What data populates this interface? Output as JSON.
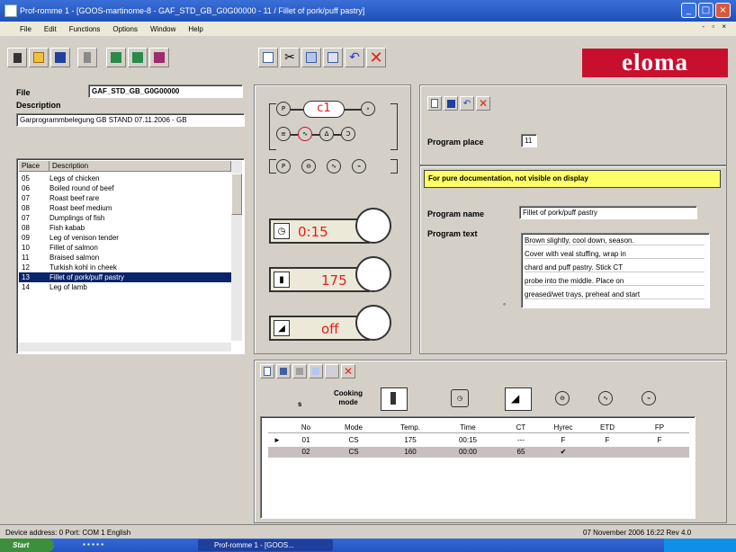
{
  "window": {
    "title": "Prof-romme 1 - [GOOS-martinome-8 - GAF_STD_GB_G0G00000 - 11 / Fillet of pork/puff pastry]"
  },
  "menu": [
    "File",
    "Edit",
    "Functions",
    "Options",
    "Window",
    "Help"
  ],
  "brand": {
    "logo_text": "eloma",
    "logo_color": "#c8102e"
  },
  "file_panel": {
    "file_label": "File",
    "file_value": "GAF_STD_GB_G0G00000",
    "description_label": "Description",
    "description_value": "Garprogrammbelegung GB STAND 07.11.2006 - GB"
  },
  "program_list": {
    "headers": [
      "Place",
      "Description"
    ],
    "rows": [
      {
        "place": "05",
        "desc": "Legs of chicken"
      },
      {
        "place": "06",
        "desc": "Boiled round of beef"
      },
      {
        "place": "07",
        "desc": "Roast beef rare"
      },
      {
        "place": "08",
        "desc": "Roast beef medium"
      },
      {
        "place": "07",
        "desc": "Dumplings of fish"
      },
      {
        "place": "08",
        "desc": "Fish kabab"
      },
      {
        "place": "09",
        "desc": "Leg of venison tender"
      },
      {
        "place": "10",
        "desc": "Fillet of salmon"
      },
      {
        "place": "11",
        "desc": "Braised salmon"
      },
      {
        "place": "12",
        "desc": "Turkish kohl in cheek"
      },
      {
        "place": "13",
        "desc": "Fillet of pork/puff pastry",
        "selected": true
      },
      {
        "place": "14",
        "desc": "Leg of lamb"
      }
    ]
  },
  "cooking_panel": {
    "mode_display": "c1",
    "time_value": "0:15",
    "temp_value": "175",
    "fan_value": "off"
  },
  "program_place": {
    "label": "Program place",
    "value": "11"
  },
  "info_panel": {
    "notice": "For pure documentation, not visible on display",
    "name_label": "Program name",
    "name_value": "Fillet of pork/puff pastry",
    "text_label": "Program text",
    "text_lines": [
      "Brown slightly, cool down, season.",
      "Cover with veal stuffing, wrap in",
      "chard and puff pastry. Stick CT",
      "probe into the middle. Place on",
      "greased/wet trays, preheat and start"
    ]
  },
  "steps": {
    "col_s": "s",
    "cooking_mode_label": "Cooking mode",
    "headers": [
      "No",
      "Mode",
      "Temp.",
      "Time",
      "CT",
      "Hyrec",
      "ETD",
      "FP"
    ],
    "rows": [
      {
        "no": "01",
        "mode": "CS",
        "temp": "175",
        "time": "00:15",
        "ct": "---",
        "hyrec": "F",
        "etd": "F",
        "fp": "F",
        "marker": "►"
      },
      {
        "no": "02",
        "mode": "CS",
        "temp": "160",
        "time": "00:00",
        "ct": "65",
        "hyrec": "✔",
        "etd": "",
        "fp": "",
        "marker": ""
      }
    ]
  },
  "statusbar": {
    "left": "Device address: 0    Port: COM 1    English",
    "right": "07 November 2006 16:22    Rev 4.0"
  },
  "taskbar": {
    "start": "Start",
    "task": "Prof-romme 1 - [GOOS..."
  }
}
